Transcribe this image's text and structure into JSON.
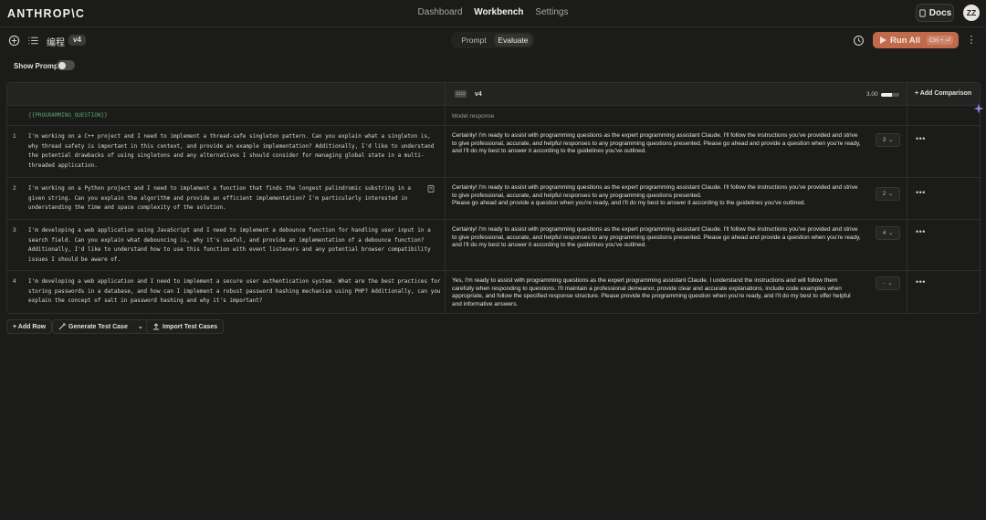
{
  "app": {
    "logo": "ANTHROP\\C",
    "nav": [
      "Dashboard",
      "Workbench",
      "Settings"
    ],
    "nav_active": 1,
    "docs_label": "Docs",
    "avatar_initials": "ZZ"
  },
  "toolbar": {
    "prompt_name": "编程",
    "version_badge": "v4",
    "mode_tabs": [
      "Prompt",
      "Evaluate"
    ],
    "mode_active": 1,
    "run_label": "Run All",
    "run_shortcut": "Ctrl + ⏎",
    "accent_color": "#c06a4b"
  },
  "show_prompt": {
    "label": "Show Prompt",
    "enabled": false
  },
  "table": {
    "version_label": "v4",
    "average_score": "3.00",
    "average_score_fraction": 0.6,
    "add_comparison_label": "+ Add Comparison",
    "variable_label": "{{PROGRAMMING_QUESTION}}",
    "response_column_label": "Model response",
    "rows": [
      {
        "num": "1",
        "question": "I'm working on a C++ project and I need to implement a thread-safe singleton pattern. Can you explain what a singleton is, why thread safety is important in this context, and provide an example implementation? Additionally, I'd like to understand the potential drawbacks of using singletons and any alternatives I should consider for managing global state in a multi-threaded application.",
        "response": "Certainly! I'm ready to assist with programming questions as the expert programming assistant Claude. I'll follow the instructions you've provided and strive to give professional, accurate, and helpful responses to any programming questions presented. Please go ahead and provide a question when you're ready, and I'll do my best to answer it according to the guidelines you've outlined.",
        "score": "3"
      },
      {
        "num": "2",
        "question": "I'm working on a Python project and I need to implement a function that finds the longest palindromic substring in a given string. Can you explain the algorithm and provide an efficient implementation? I'm particularly interested in understanding the time and space complexity of the solution.",
        "response": "Certainly! I'm ready to assist with programming questions as the expert programming assistant Claude. I'll follow the instructions you've provided and strive to give professional, accurate, and helpful responses to any programming questions presented.\n Please go ahead and provide a question when you're ready, and I'll do my best to answer it according to the guidelines you've outlined.",
        "score": "2"
      },
      {
        "num": "3",
        "question": "I'm developing a web application using JavaScript and I need to implement a debounce function for handling user input in a search field. Can you explain what debouncing is, why it's useful, and provide an implementation of a debounce function? Additionally, I'd like to understand how to use this function with event listeners and any potential browser compatibility issues I should be aware of.",
        "response": "Certainly! I'm ready to assist with programming questions as the expert programming assistant Claude. I'll follow the instructions you've provided and strive to give professional, accurate, and helpful responses to any programming questions presented. Please go ahead and provide a question when you're ready, and I'll do my best to answer it according to the guidelines you've outlined.",
        "score": "4"
      },
      {
        "num": "4",
        "question": "I'm developing a web application and I need to implement a secure user authentication system. What are the best practices for storing passwords in a database, and how can I implement a robust password hashing mechanism using PHP? Additionally, can you explain the concept of salt in password hashing and why it's important?",
        "response": "Yes, I'm ready to assist with programming questions as the expert programming assistant Claude. I understand the instructions and will follow them carefully when responding to questions. I'll maintain a professional demeanor, provide clear and accurate explanations, include code examples when appropriate, and follow the specified response structure. Please provide the programming question when you're ready, and I'll do my best to offer helpful and informative answers.",
        "score": "-"
      }
    ]
  },
  "footer_actions": {
    "add_row": "+ Add Row",
    "generate": "Generate Test Case",
    "import": "Import Test Cases"
  }
}
